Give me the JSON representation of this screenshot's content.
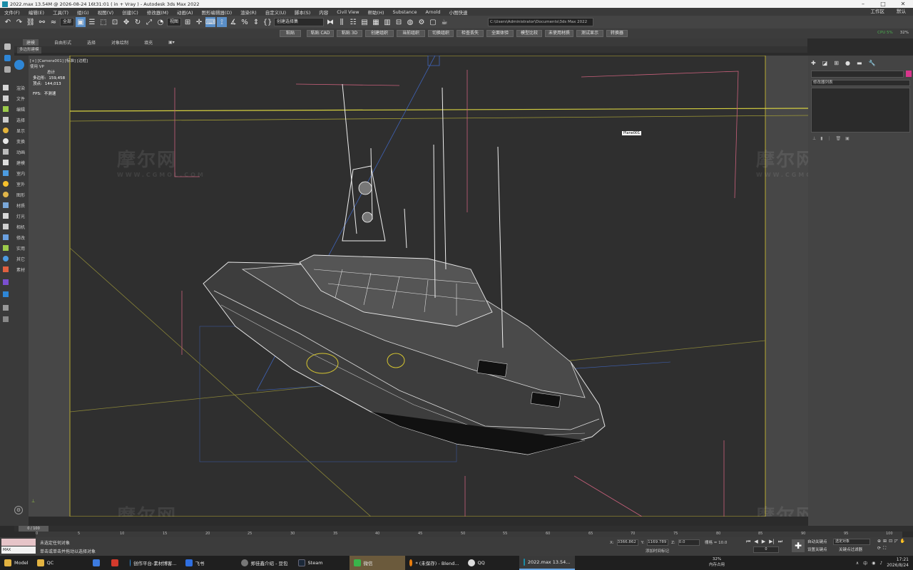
{
  "window": {
    "title": "2022.max  13.54M @ 2026-08-24 16t31:01  ( in + Vray ) - Autodesk 3ds Max 2022",
    "workspace_label": "工作区",
    "workspace_value": "默认"
  },
  "menu": [
    "文件(F)",
    "编辑(E)",
    "工具(T)",
    "组(G)",
    "视图(V)",
    "创建(C)",
    "修改器(M)",
    "动画(A)",
    "图形编辑器(D)",
    "渲染(R)",
    "自定义(U)",
    "脚本(S)",
    "内容",
    "Civil View",
    "帮助(H)",
    "Substance",
    "Arnold",
    "小图快速"
  ],
  "toolbar": {
    "filter_select": "全部",
    "ref_coord": "视图",
    "named_selection": "创建选择集",
    "project_path": "C:\\Users\\Administrator\\Documents\\3ds Max 2022"
  },
  "ribbon": {
    "hint": "",
    "buttons": [
      "粘贴",
      "粘贴 CAD",
      "粘贴 3D",
      "创建组织",
      "当前组织",
      "切换组织",
      "检查丢失",
      "全面体验",
      "模型比较",
      "未使用材质",
      "测试显示",
      "转换器"
    ],
    "cpu_label": "CPU 5%",
    "gpu_label": "32%"
  },
  "explorer_tabs": [
    "建模",
    "自由形式",
    "选择",
    "对象绘制",
    "填充"
  ],
  "explorer_subtab": "多边形建模",
  "left_commands": [
    "渲染",
    "文件",
    "编辑",
    "选择",
    "显示",
    "变换",
    "动画",
    "建模",
    "室内",
    "室外",
    "图形",
    "材质",
    "灯光",
    "相机",
    "修改",
    "实用",
    "其它",
    "素材"
  ],
  "viewport": {
    "label_line1": "[+] [Camera001] [标准] [边框]",
    "label_line2": "使用 VP",
    "stats_total": "总计",
    "stats_poly_label": "多边形:",
    "stats_poly_value": "159,458",
    "stats_vert_label": "顶点:",
    "stats_vert_value": "144,013",
    "fps_label": "FPS:",
    "fps_value": "不测速",
    "plane_tag": "Plane001",
    "watermark": "摩尔网",
    "watermark_url": "WWW.CGMOL.COM"
  },
  "command_panel": {
    "modifier_list": "修改器列表"
  },
  "timeline": {
    "slider": "0 / 100",
    "ticks": [
      "0",
      "5",
      "10",
      "15",
      "20",
      "25",
      "30",
      "35",
      "40",
      "45",
      "50",
      "55",
      "60",
      "65",
      "70",
      "75",
      "80",
      "85",
      "90",
      "95",
      "100"
    ]
  },
  "status": {
    "script_value": "MAX",
    "msg1": "未选定任何对象",
    "msg2": "单击或单击并拖动以选择对象",
    "x_label": "X:",
    "x_value": "3366.862",
    "y_label": "Y:",
    "y_value": "1169.789",
    "z_label": "Z:",
    "z_value": "0.0",
    "grid_label": "栅格 = 10.0",
    "add_time_tag": "添加时间标记",
    "autokey": "自动关键点",
    "selected": "选定对象",
    "set_key": "设置关键点",
    "key_filter": "关键点过滤器",
    "frame": "0"
  },
  "taskbar": {
    "items": [
      {
        "label": "Model",
        "color": "#e3b341"
      },
      {
        "label": "QC",
        "color": "#e3b341"
      },
      {
        "label": "",
        "color": "#3d7be0"
      },
      {
        "label": "",
        "color": "#d33a2c"
      },
      {
        "label": "创作平台-素材博客...",
        "color": "#2f8ad8"
      },
      {
        "label": "飞书",
        "color": "#2f6fe0"
      },
      {
        "label": "郑佳鑫介绍 - 豆包",
        "color": "#555"
      },
      {
        "label": "Steam",
        "color": "#1b2838"
      },
      {
        "label": "微信",
        "color": "#3ab54a"
      },
      {
        "label": "* (未保存) - Blend...",
        "color": "#e87d0d"
      },
      {
        "label": "QQ",
        "color": "#ddd"
      },
      {
        "label": "2022.max  13.54...",
        "color": "#1b8ca8"
      }
    ],
    "mem_line1": "32%",
    "mem_line2": "内存占用",
    "time": "17:21",
    "date": "2026/8/24"
  }
}
